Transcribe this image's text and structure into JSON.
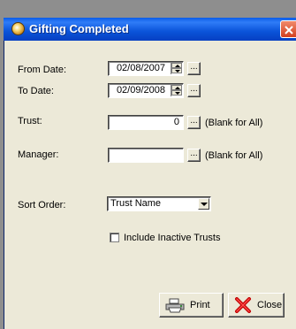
{
  "window": {
    "title": "Gifting Completed"
  },
  "form": {
    "from_date": {
      "label": "From Date:",
      "value": "02/08/2007",
      "browse": "..."
    },
    "to_date": {
      "label": "To Date:",
      "value": "02/09/2008",
      "browse": "..."
    },
    "trust": {
      "label": "Trust:",
      "value": "0",
      "browse": "...",
      "hint": "(Blank for All)"
    },
    "manager": {
      "label": "Manager:",
      "value": "",
      "browse": "...",
      "hint": "(Blank for All)"
    },
    "sort_order": {
      "label": "Sort Order:",
      "value": "Trust Name"
    },
    "include_inactive": {
      "label": "Include Inactive Trusts",
      "checked": false
    }
  },
  "buttons": {
    "print": {
      "label": "Print",
      "icon": "printer-icon"
    },
    "close": {
      "label": "Close",
      "icon": "red-x-icon"
    }
  },
  "colors": {
    "titlebar": "#0a53d9",
    "dialog_bg": "#ece9d8",
    "close_button": "#d3401f"
  }
}
